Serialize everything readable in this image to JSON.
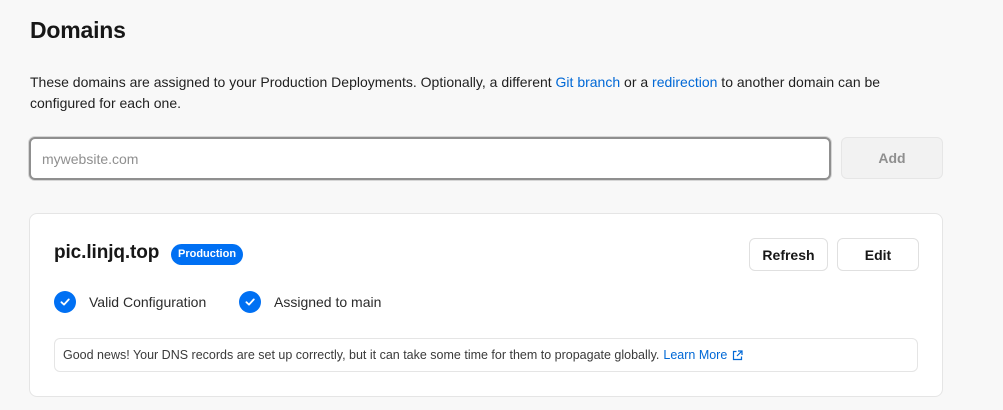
{
  "page": {
    "title": "Domains",
    "description": {
      "text_before": "These domains are assigned to your Production Deployments. Optionally, a different ",
      "link_git_branch": "Git branch",
      "text_middle": " or a ",
      "link_redirection": "redirection",
      "text_after": " to another domain can be configured for each one."
    }
  },
  "add_form": {
    "placeholder": "mywebsite.com",
    "value": "",
    "add_label": "Add"
  },
  "domain_card": {
    "domain": "pic.linjq.top",
    "environment_badge": "Production",
    "refresh_label": "Refresh",
    "edit_label": "Edit",
    "statuses": [
      {
        "label": "Valid Configuration",
        "icon": "check-circle-icon"
      },
      {
        "label": "Assigned to main",
        "icon": "check-circle-icon"
      }
    ],
    "note": {
      "text": "Good news! Your DNS records are set up correctly, but it can take some time for them to propagate globally.",
      "link_label": "Learn More",
      "link_icon": "external-link-icon"
    }
  },
  "colors": {
    "accent": "#0070f3",
    "link": "#0068d6",
    "page_background": "#f8f8f8",
    "card_background": "#ffffff"
  }
}
